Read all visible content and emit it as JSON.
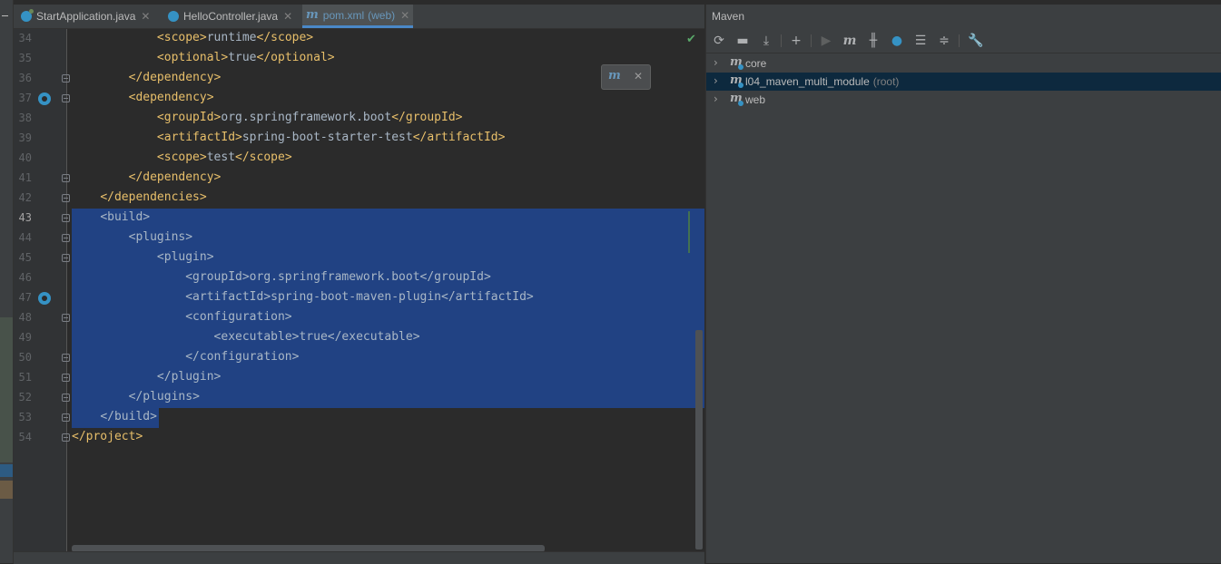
{
  "tabs": [
    {
      "label": "StartApplication.java",
      "active": false
    },
    {
      "label": "HelloController.java",
      "active": false
    },
    {
      "label": "pom.xml",
      "sub": "(web)",
      "active": true
    }
  ],
  "editor": {
    "lines": [
      {
        "num": "34",
        "indent": "            ",
        "parts": [
          [
            "tag",
            "<scope>"
          ],
          [
            "txt",
            "runtime"
          ],
          [
            "tag",
            "</scope>"
          ]
        ]
      },
      {
        "num": "35",
        "indent": "            ",
        "parts": [
          [
            "tag",
            "<optional>"
          ],
          [
            "txt",
            "true"
          ],
          [
            "tag",
            "</optional>"
          ]
        ]
      },
      {
        "num": "36",
        "indent": "        ",
        "parts": [
          [
            "tag",
            "</dependency>"
          ]
        ]
      },
      {
        "num": "37",
        "indent": "        ",
        "parts": [
          [
            "tag",
            "<dependency>"
          ]
        ]
      },
      {
        "num": "38",
        "indent": "            ",
        "parts": [
          [
            "tag",
            "<groupId>"
          ],
          [
            "txt",
            "org.springframework.boot"
          ],
          [
            "tag",
            "</groupId>"
          ]
        ]
      },
      {
        "num": "39",
        "indent": "            ",
        "parts": [
          [
            "tag",
            "<artifactId>"
          ],
          [
            "txt",
            "spring-boot-starter-test"
          ],
          [
            "tag",
            "</artifactId>"
          ]
        ]
      },
      {
        "num": "40",
        "indent": "            ",
        "parts": [
          [
            "tag",
            "<scope>"
          ],
          [
            "txt",
            "test"
          ],
          [
            "tag",
            "</scope>"
          ]
        ]
      },
      {
        "num": "41",
        "indent": "        ",
        "parts": [
          [
            "tag",
            "</dependency>"
          ]
        ]
      },
      {
        "num": "42",
        "indent": "    ",
        "parts": [
          [
            "tag",
            "</dependencies>"
          ]
        ]
      },
      {
        "num": "43",
        "indent": "    ",
        "parts": [
          [
            "txt",
            "<build>"
          ]
        ]
      },
      {
        "num": "44",
        "indent": "        ",
        "parts": [
          [
            "txt",
            "<plugins>"
          ]
        ]
      },
      {
        "num": "45",
        "indent": "            ",
        "parts": [
          [
            "txt",
            "<plugin>"
          ]
        ]
      },
      {
        "num": "46",
        "indent": "                ",
        "parts": [
          [
            "txt",
            "<groupId>org.springframework.boot</groupId>"
          ]
        ]
      },
      {
        "num": "47",
        "indent": "                ",
        "parts": [
          [
            "txt",
            "<artifactId>spring-boot-maven-plugin</artifactId>"
          ]
        ]
      },
      {
        "num": "48",
        "indent": "                ",
        "parts": [
          [
            "txt",
            "<configuration>"
          ]
        ]
      },
      {
        "num": "49",
        "indent": "                    ",
        "parts": [
          [
            "txt",
            "<executable>true</executable>"
          ]
        ]
      },
      {
        "num": "50",
        "indent": "                ",
        "parts": [
          [
            "txt",
            "</configuration>"
          ]
        ]
      },
      {
        "num": "51",
        "indent": "            ",
        "parts": [
          [
            "txt",
            "</plugin>"
          ]
        ]
      },
      {
        "num": "52",
        "indent": "        ",
        "parts": [
          [
            "txt",
            "</plugins>"
          ]
        ]
      },
      {
        "num": "53",
        "indent": "    ",
        "parts": [
          [
            "txt",
            "</build>"
          ]
        ]
      },
      {
        "num": "54",
        "indent": "",
        "parts": [
          [
            "tag",
            "</project>"
          ]
        ]
      }
    ]
  },
  "maven": {
    "title": "Maven",
    "toolbar": [
      "reload-icon",
      "add-folder-icon",
      "download-icon",
      "plus-icon",
      "run-icon",
      "maven-goal-icon",
      "toggle-offline-icon",
      "lightning-icon",
      "expand-all-icon",
      "collapse-all-icon",
      "wrench-icon"
    ],
    "tree": [
      {
        "label": "core",
        "sub": "",
        "selected": false
      },
      {
        "label": "l04_maven_multi_module",
        "sub": "(root)",
        "selected": true
      },
      {
        "label": "web",
        "sub": "",
        "selected": false
      }
    ]
  },
  "colors": {
    "tag": "#e8bf6a",
    "text": "#a9b7c6",
    "selection": "#214283",
    "accent": "#4a88c7"
  }
}
